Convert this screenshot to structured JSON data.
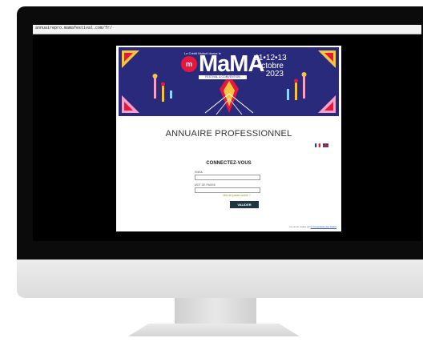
{
  "browser": {
    "url": "annuairepro.mamafestival.com/fr/"
  },
  "banner": {
    "tagline": "Le Crédit Mutuel donne le",
    "logo_badge": "m",
    "logo": "MaMA",
    "logo_subtitle": "FESTIVAL & CONVENTION",
    "dates": [
      "11•12•13",
      "octobre",
      "2023"
    ],
    "colors": {
      "background": "#2a2a7c",
      "accent_red": "#e5173f",
      "accent_yellow": "#f5c542"
    }
  },
  "page": {
    "title": "ANNUAIRE PROFESSIONNEL",
    "languages": [
      "french-flag-icon",
      "english-flag-icon"
    ],
    "login": {
      "heading": "CONNECTEZ-VOUS",
      "email_label": "EMAIL",
      "email_value": "",
      "password_label": "MOT DE PASSE",
      "password_value": "",
      "forgot_password": "Mot de passe oublié ?",
      "submit": "VALIDER"
    },
    "footer": {
      "prefix": "Ce carnet réalisé par",
      "link": "la Coopérative des Ondes"
    },
    "colors": {
      "button": "#1f3640",
      "link": "#8a9a2a"
    }
  }
}
